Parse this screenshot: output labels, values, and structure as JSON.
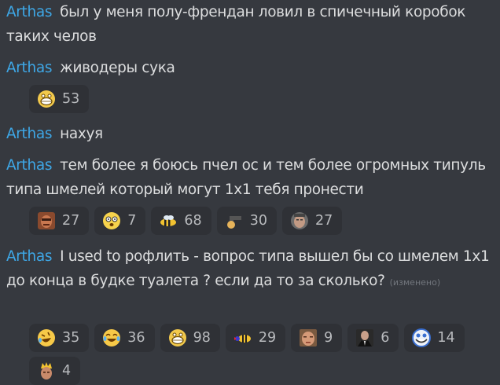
{
  "messages": [
    {
      "author": "Arthas",
      "text": "был у меня полу-френдан ловил в спичечный коробок таких челов",
      "edited": ""
    },
    {
      "author": "Arthas",
      "text": "живодеры сука",
      "edited": ""
    },
    {
      "author": "Arthas",
      "text": "нахуя",
      "edited": ""
    },
    {
      "author": "Arthas",
      "text": "тем более я боюсь пчел ос и тем более огромных типуль типа шмелей который могут 1х1 тебя пронести",
      "edited": ""
    },
    {
      "author": "Arthas",
      "text": "I used to рофлить - вопрос типа вышел бы со шмелем 1х1 до конца в будке туалета ? если да то за сколько?",
      "edited": "(изменено)"
    }
  ],
  "reactions": {
    "msg2": [
      {
        "icon": "grinning-emote-icon",
        "count": "53"
      }
    ],
    "msg4": [
      {
        "icon": "face-emote-icon",
        "count": "27"
      },
      {
        "icon": "dizzy-face-icon",
        "count": "7"
      },
      {
        "icon": "bee-icon",
        "count": "68"
      },
      {
        "icon": "gun-hand-icon",
        "count": "30"
      },
      {
        "icon": "man-face-emote-icon",
        "count": "27"
      }
    ],
    "msg5": [
      {
        "icon": "rofl-icon",
        "count": "35"
      },
      {
        "icon": "joy-icon",
        "count": "36"
      },
      {
        "icon": "grinning-emote-icon",
        "count": "98"
      },
      {
        "icon": "bee-flying-icon",
        "count": "29"
      },
      {
        "icon": "man-portrait-icon",
        "count": "9"
      },
      {
        "icon": "suit-man-icon",
        "count": "6"
      },
      {
        "icon": "troll-face-icon",
        "count": "14"
      },
      {
        "icon": "king-emote-icon",
        "count": "4"
      }
    ]
  },
  "colors": {
    "background": "#36393f",
    "author": "#3ea7e6",
    "text": "#dcddde",
    "reaction_bg": "#2f3136",
    "edited": "#72767d"
  }
}
